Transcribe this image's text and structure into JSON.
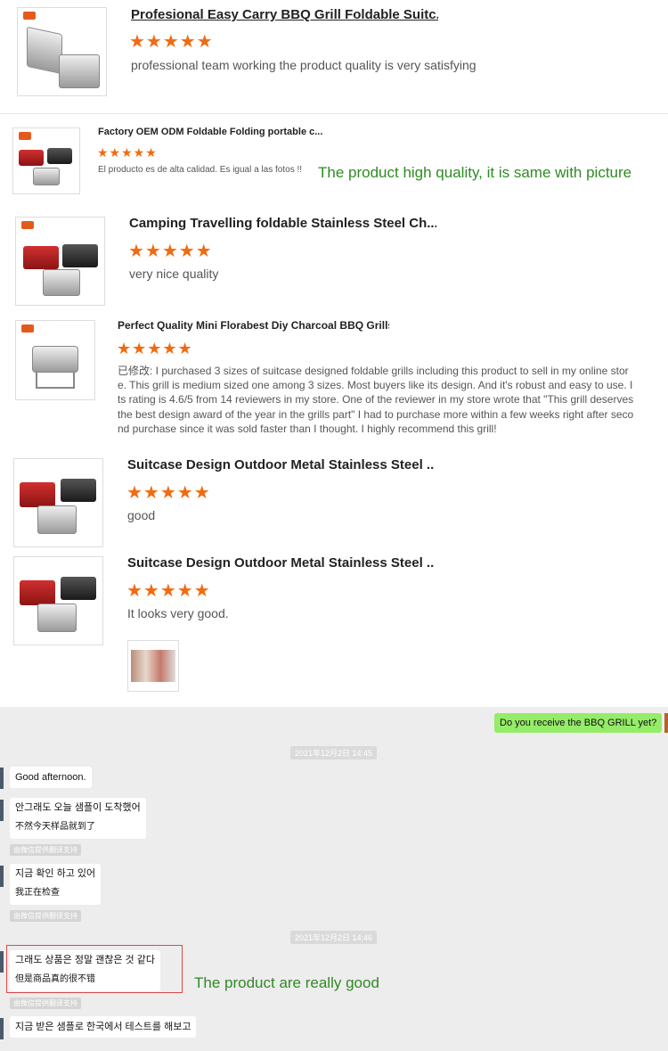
{
  "reviews": [
    {
      "title": "Profesional Easy Carry BBQ Grill Foldable Suitc...",
      "stars": "★★★★★",
      "text": "professional team working the product quality is very satisfying"
    },
    {
      "title": "Factory OEM ODM Foldable Folding portable c...",
      "stars": "★★★★★",
      "text": "El producto es de alta calidad. Es igual a las fotos !!",
      "note": "The product high quality, it is same with picture"
    },
    {
      "title": "Camping Travelling foldable Stainless Steel Ch...",
      "stars": "★★★★★",
      "text": "very nice quality"
    },
    {
      "title": "Perfect Quality Mini Florabest Diy Charcoal BBQ Grills...",
      "stars": "★★★★★",
      "text": "已修改: I purchased 3 sizes of suitcase designed foldable grills including this product to sell in my online store. This grill is medium sized one among 3 sizes. Most buyers like its design. And it's robust and easy to use. Its rating is 4.6/5 from 14 reviewers in my store. One of the reviewer in my store wrote that \"This grill deserves the best design award of the year in the grills part\" I had to purchase more within a few weeks right after second purchase since it was sold faster than I thought. I highly recommend this grill!"
    },
    {
      "title": "Suitcase Design Outdoor Metal Stainless Steel ...",
      "stars": "★★★★★",
      "text": "good"
    },
    {
      "title": "Suitcase Design Outdoor Metal Stainless Steel ...",
      "stars": "★★★★★",
      "text": "It looks very good."
    }
  ],
  "chat": {
    "sent": "Do you receive the BBQ GRILL yet?",
    "timestamp1": "2021年12月2日 14:45",
    "msg1": "Good afternoon.",
    "msg2_ko": "안그래도 오늘 샘플이 도착했어",
    "msg2_zh": "不然今天样品就到了",
    "trans_label": "由微信提供翻译支持",
    "msg3_ko": "지금 확인 하고 있어",
    "msg3_zh": "我正在检查",
    "timestamp2": "2021年12月2日 14:46",
    "msg4_ko": "그래도 상품은 정말 괜찮은 것 같다",
    "msg4_zh": "但是商品真的很不错",
    "note": "The product are really good",
    "msg5_ko": "지금 받은 샘플로 한국에서 테스트를 해보고"
  }
}
